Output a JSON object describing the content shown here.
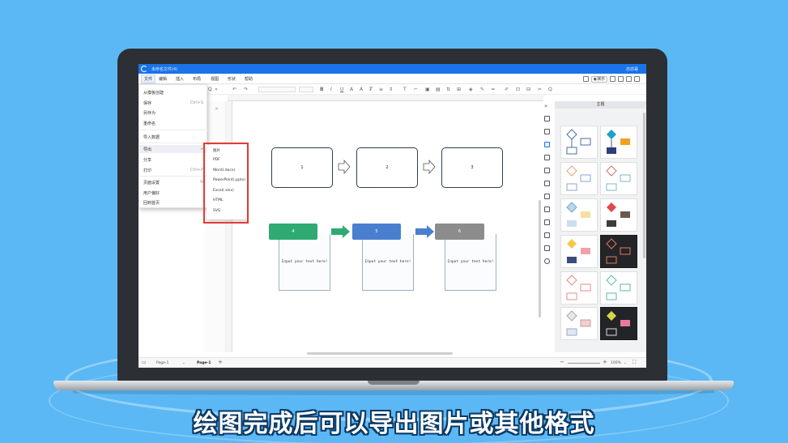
{
  "app": {
    "file_title": "未命名文件(4)",
    "user_name": "亦亦哥",
    "demo_label": "演示"
  },
  "menubar": {
    "items": [
      "文件",
      "编辑",
      "插入",
      "布局",
      "视图",
      "形状",
      "帮助"
    ]
  },
  "file_menu": {
    "items": [
      {
        "label": "从模板创建",
        "shortcut": ""
      },
      {
        "label": "保存",
        "shortcut": "Ctrl+S"
      },
      {
        "label": "另存为",
        "shortcut": ""
      },
      {
        "label": "重命名",
        "shortcut": ""
      },
      {
        "label": "导入数据",
        "shortcut": ""
      },
      {
        "label": "导出",
        "shortcut": "▸"
      },
      {
        "label": "分享",
        "shortcut": ""
      },
      {
        "label": "打印",
        "shortcut": "Ctrl+P"
      },
      {
        "label": "页面设置",
        "shortcut": "N"
      },
      {
        "label": "用户偏好",
        "shortcut": ""
      },
      {
        "label": "回到首页",
        "shortcut": ""
      }
    ]
  },
  "export_submenu": {
    "items": [
      "图片",
      "PDF",
      "Word(.docx)",
      "PowerPoint(.pptx)",
      "Excel(.xlsx)",
      "HTML",
      "SVG"
    ]
  },
  "diagram": {
    "row1": [
      "1",
      "2",
      "3"
    ],
    "row2_headers": [
      "4",
      "5",
      "6"
    ],
    "card_text": "Input your text here!",
    "colors": {
      "green": "#2eaa72",
      "blue": "#4a7fd0",
      "gray": "#8c8c8c",
      "arrow_green": "#2eaa72",
      "arrow_blue": "#4a7fd0"
    }
  },
  "theme_panel": {
    "title": "主题"
  },
  "statusbar": {
    "page_select": "Page-1",
    "page_tab": "Page-1",
    "add": "+",
    "zoom": "100%"
  },
  "caption": "绘图完成后可以导出图片或其他格式"
}
